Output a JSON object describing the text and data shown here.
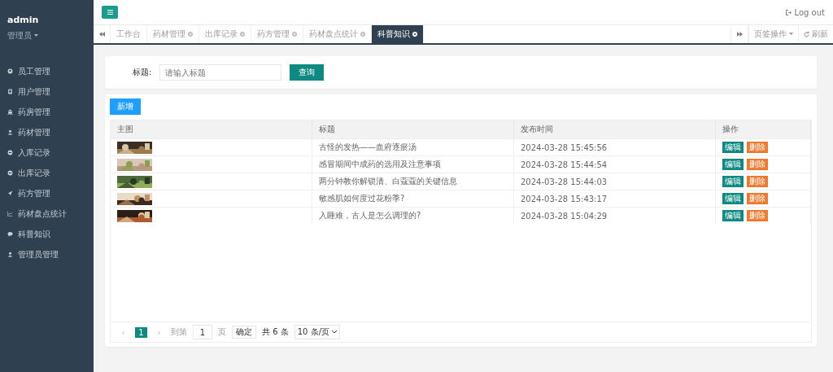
{
  "sidebar": {
    "user": "admin",
    "role": "管理员",
    "items": [
      {
        "label": "员工管理",
        "kind": "person-circle"
      },
      {
        "label": "用户管理",
        "kind": "card"
      },
      {
        "label": "药房管理",
        "kind": "building"
      },
      {
        "label": "药材管理",
        "kind": "person"
      },
      {
        "label": "入库记录",
        "kind": "circle"
      },
      {
        "label": "出库记录",
        "kind": "circle"
      },
      {
        "label": "药方管理",
        "kind": "send"
      },
      {
        "label": "药材盘点统计",
        "kind": "chart"
      },
      {
        "label": "科普知识",
        "kind": "chat"
      },
      {
        "label": "管理员管理",
        "kind": "person"
      }
    ]
  },
  "topbar": {
    "logout": "Log out"
  },
  "tabs": [
    {
      "label": "工作台",
      "closable": false,
      "selected": false
    },
    {
      "label": "药材管理",
      "closable": true,
      "selected": false
    },
    {
      "label": "出库记录",
      "closable": true,
      "selected": false
    },
    {
      "label": "药方管理",
      "closable": true,
      "selected": false
    },
    {
      "label": "药材盘点统计",
      "closable": true,
      "selected": false
    },
    {
      "label": "科普知识",
      "closable": true,
      "selected": true
    }
  ],
  "tab_actions": {
    "page_ops": "页签操作",
    "refresh": "刷新"
  },
  "search": {
    "label": "标题:",
    "placeholder": "请输入标题",
    "button": "查询"
  },
  "add_button": "新增",
  "table": {
    "columns": [
      "主图",
      "标题",
      "发布时间",
      "操作"
    ],
    "rows": [
      {
        "title": "古怪的发热——血府逐瘀汤",
        "time": "2024-03-28 15:45:56",
        "edit": "编辑",
        "delete": "删除"
      },
      {
        "title": "感冒期间中成药的选用及注意事项",
        "time": "2024-03-28 15:44:54",
        "edit": "编辑",
        "delete": "删除"
      },
      {
        "title": "两分钟教你解锁清、白蔻蔻的关键信息",
        "time": "2024-03-28 15:44:03",
        "edit": "编辑",
        "delete": "删除"
      },
      {
        "title": "敏感肌如何度过花粉季?",
        "time": "2024-03-28 15:43:17",
        "edit": "编辑",
        "delete": "删除"
      },
      {
        "title": "入睡难，古人是怎么调理的?",
        "time": "2024-03-28 15:04:29",
        "edit": "编辑",
        "delete": "删除"
      }
    ]
  },
  "pagination": {
    "prev": "‹",
    "pages": [
      {
        "label": "1",
        "selected": true
      }
    ],
    "next": "›",
    "goto": "到第",
    "page_value": "1",
    "page_unit": "页",
    "confirm": "确定",
    "total": "共 6 条",
    "page_size": "10 条/页"
  }
}
